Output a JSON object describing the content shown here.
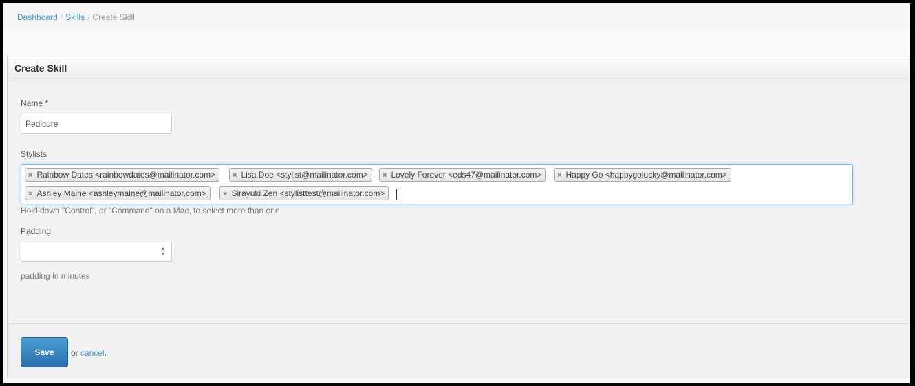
{
  "breadcrumb": {
    "items": [
      {
        "label": "Dashboard"
      },
      {
        "label": "Skills"
      }
    ],
    "current": "Create Skill",
    "separator": "/"
  },
  "panel": {
    "title": "Create Skill"
  },
  "form": {
    "name": {
      "label": "Name *",
      "value": "Pedicure"
    },
    "stylists": {
      "label": "Stylists",
      "selected": [
        "Rainbow Dates <rainbowdates@mailinator.com>",
        "Lisa Doe <stylist@mailinator.com>",
        "Lovely Forever <eds47@mailinator.com>",
        "Happy Go <happygolucky@mailinator.com>",
        "Ashley Maine <ashleymaine@mailinator.com>",
        "Sirayuki Zen <stylisttest@mailinator.com>"
      ],
      "remove_glyph": "×",
      "help": "Hold down \"Control\", or \"Command\" on a Mac, to select more than one."
    },
    "padding": {
      "label": "Padding",
      "value": "",
      "help": "padding in minutes"
    }
  },
  "actions": {
    "save_label": "Save",
    "or_text": "or",
    "cancel_label": "cancel",
    "period": "."
  },
  "colors": {
    "link": "#3c9fd4",
    "primary_button": "#2a6ead",
    "focus_border": "#7fb8e6"
  }
}
